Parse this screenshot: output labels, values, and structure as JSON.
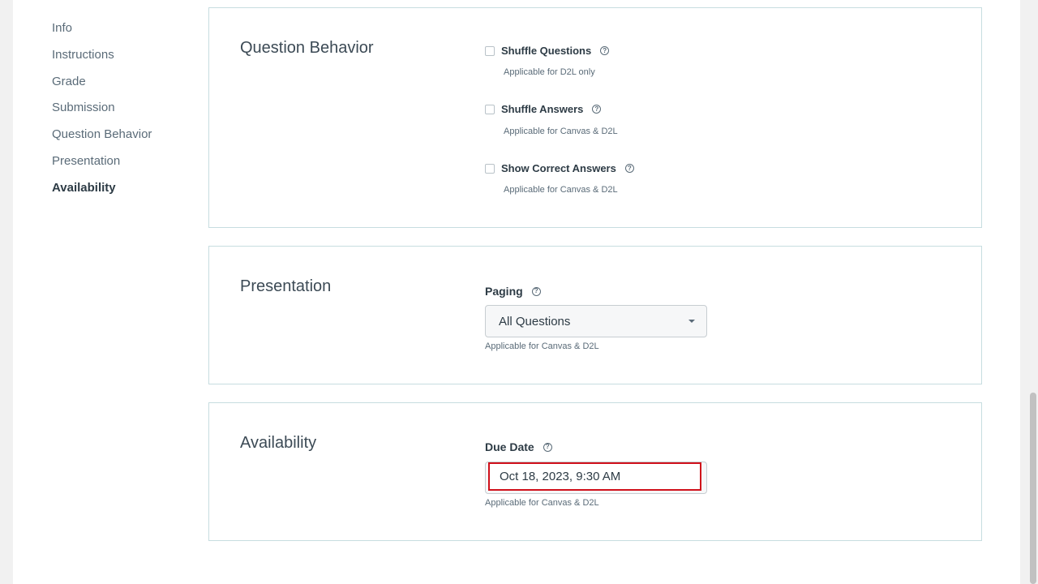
{
  "sidebar": {
    "items": [
      {
        "label": "Info"
      },
      {
        "label": "Instructions"
      },
      {
        "label": "Grade"
      },
      {
        "label": "Submission"
      },
      {
        "label": "Question Behavior"
      },
      {
        "label": "Presentation"
      },
      {
        "label": "Availability",
        "active": true
      }
    ]
  },
  "question_behavior": {
    "title": "Question Behavior",
    "options": [
      {
        "label": "Shuffle Questions",
        "checked": false,
        "hint": "Applicable for D2L only"
      },
      {
        "label": "Shuffle Answers",
        "checked": false,
        "hint": "Applicable for Canvas & D2L"
      },
      {
        "label": "Show Correct Answers",
        "checked": false,
        "hint": "Applicable for Canvas & D2L"
      }
    ]
  },
  "presentation": {
    "title": "Presentation",
    "paging_label": "Paging",
    "paging_value": "All Questions",
    "hint": "Applicable for Canvas & D2L"
  },
  "availability": {
    "title": "Availability",
    "due_date_label": "Due Date",
    "due_date_value": "Oct 18, 2023, 9:30 AM",
    "hint": "Applicable for Canvas & D2L"
  },
  "colors": {
    "border": "#c7dde0",
    "focus_ring": "#d0101b",
    "text": "#2d3b45",
    "muted": "#5a6b78"
  }
}
